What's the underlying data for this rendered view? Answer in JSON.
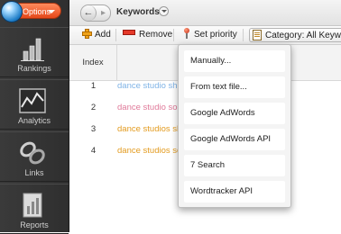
{
  "sidebar": {
    "options_label": "Options",
    "items": [
      {
        "label": "Rankings",
        "icon": "bar-chart-icon"
      },
      {
        "label": "Analytics",
        "icon": "line-chart-icon"
      },
      {
        "label": "Links",
        "icon": "chain-link-icon"
      },
      {
        "label": "Reports",
        "icon": "report-icon"
      }
    ]
  },
  "header": {
    "title": "Keywords"
  },
  "toolbar": {
    "add_label": "Add",
    "remove_label": "Remove",
    "priority_label": "Set priority",
    "category_label": "Category: All Keywords"
  },
  "table": {
    "index_header": "Index",
    "rows": [
      {
        "index": "1",
        "keyword": "dance studio sh",
        "color": "#7fb3e6"
      },
      {
        "index": "2",
        "keyword": "dance studio so",
        "color": "#e07a9a"
      },
      {
        "index": "3",
        "keyword": "dance studios sh",
        "color": "#e39b1f"
      },
      {
        "index": "4",
        "keyword": "dance studios so",
        "color": "#e39b1f"
      }
    ]
  },
  "menu": {
    "items": [
      "Manually...",
      "From text file...",
      "Google AdWords",
      "Google AdWords API",
      "7 Search",
      "Wordtracker API"
    ]
  },
  "colors": {
    "sidebar_bg": "#333333",
    "options_orange": "#e4481a"
  }
}
